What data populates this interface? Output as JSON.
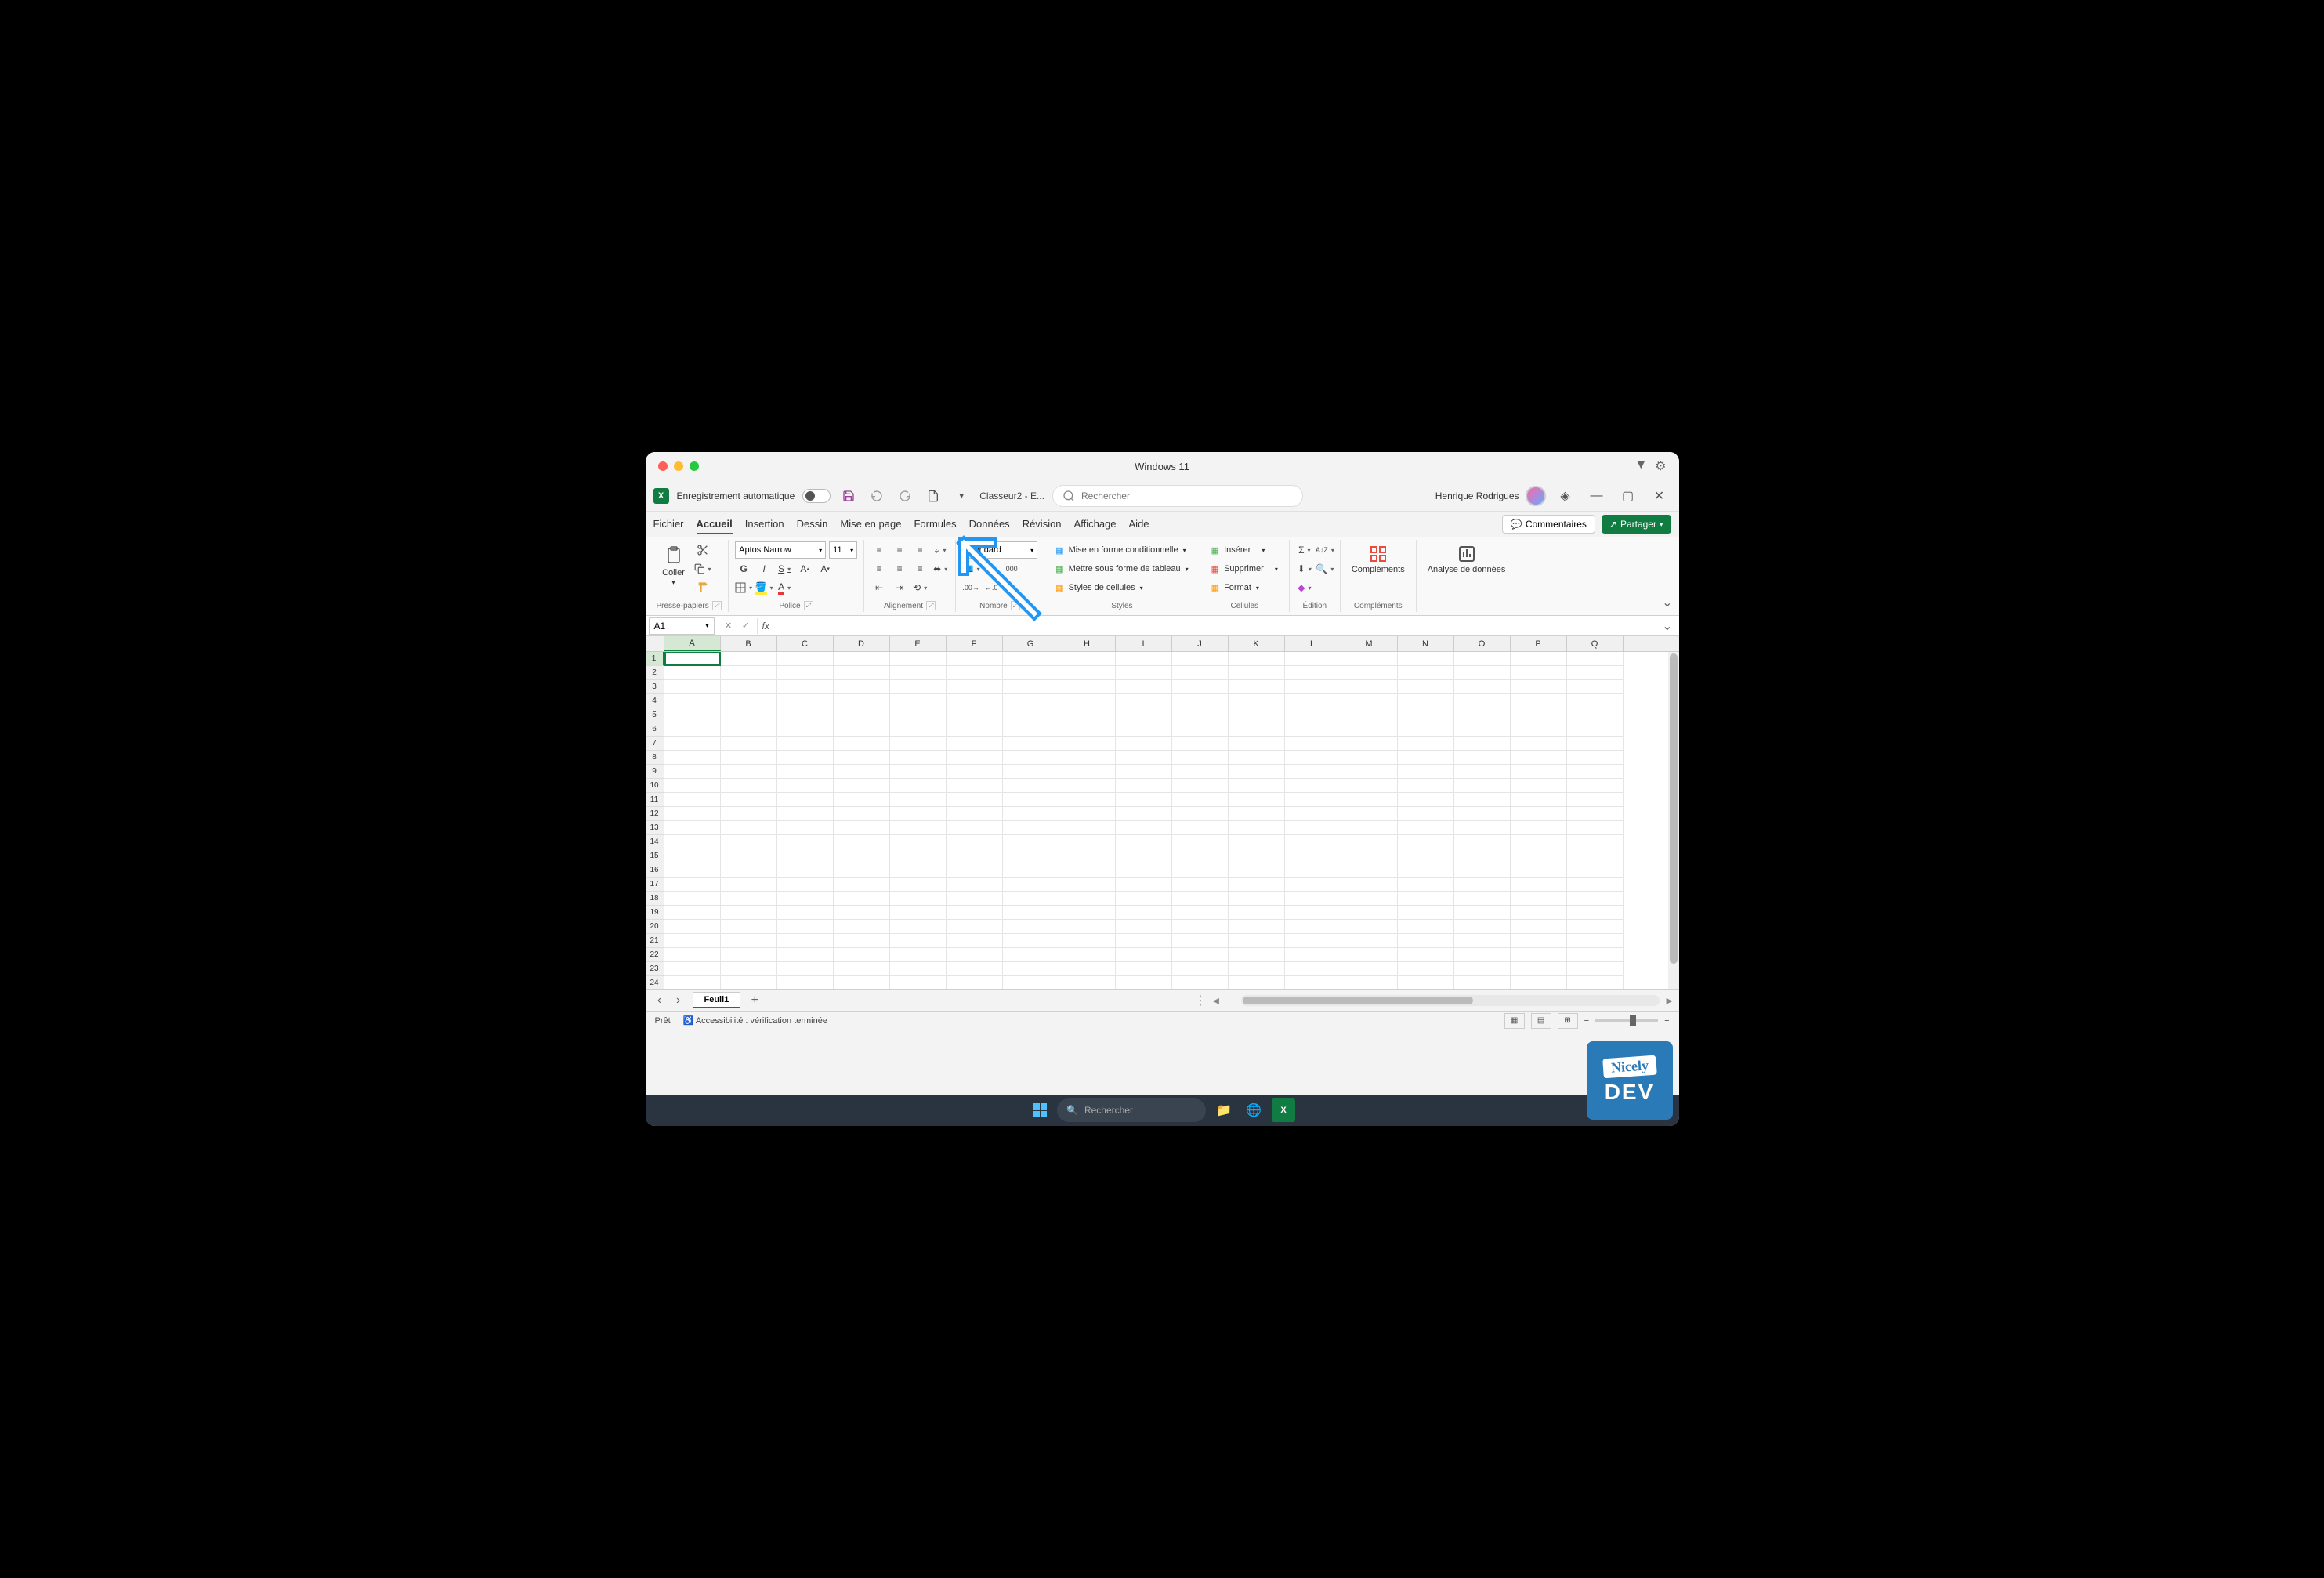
{
  "mac_title": "Windows 11",
  "quick_access": {
    "autosave_label": "Enregistrement automatique",
    "filename": "Classeur2  -  E...",
    "search_placeholder": "Rechercher",
    "user_name": "Henrique Rodrigues"
  },
  "tabs": {
    "items": [
      "Fichier",
      "Accueil",
      "Insertion",
      "Dessin",
      "Mise en page",
      "Formules",
      "Données",
      "Révision",
      "Affichage",
      "Aide"
    ],
    "active_index": 1,
    "comments": "Commentaires",
    "share": "Partager"
  },
  "ribbon": {
    "clipboard": {
      "label": "Presse-papiers",
      "paste": "Coller"
    },
    "font": {
      "label": "Police",
      "font_name": "Aptos Narrow",
      "font_size": "11",
      "bold": "G",
      "italic": "I",
      "underline": "S"
    },
    "alignment": {
      "label": "Alignement"
    },
    "number": {
      "label": "Nombre",
      "format": "Standard"
    },
    "styles": {
      "label": "Styles",
      "conditional": "Mise en forme conditionnelle",
      "table": "Mettre sous forme de tableau",
      "cell_styles": "Styles de cellules"
    },
    "cells": {
      "label": "Cellules",
      "insert": "Insérer",
      "delete": "Supprimer",
      "format": "Format"
    },
    "editing": {
      "label": "Édition"
    },
    "addins": {
      "label": "Compléments",
      "btn": "Compléments"
    },
    "analysis": {
      "label": "",
      "btn": "Analyse de données"
    }
  },
  "formula_bar": {
    "name_box": "A1",
    "fx": "fx"
  },
  "grid": {
    "columns": [
      "A",
      "B",
      "C",
      "D",
      "E",
      "F",
      "G",
      "H",
      "I",
      "J",
      "K",
      "L",
      "M",
      "N",
      "O",
      "P",
      "Q"
    ],
    "rows": [
      1,
      2,
      3,
      4,
      5,
      6,
      7,
      8,
      9,
      10,
      11,
      12,
      13,
      14,
      15,
      16,
      17,
      18,
      19,
      20,
      21,
      22,
      23,
      24
    ],
    "active_cell": "A1"
  },
  "sheet_bar": {
    "sheet_name": "Feuil1"
  },
  "status_bar": {
    "ready": "Prêt",
    "accessibility": "Accessibilité : vérification terminée"
  },
  "taskbar": {
    "search": "Rechercher"
  },
  "watermark": {
    "line1": "Nicely",
    "line2": "DEV"
  }
}
